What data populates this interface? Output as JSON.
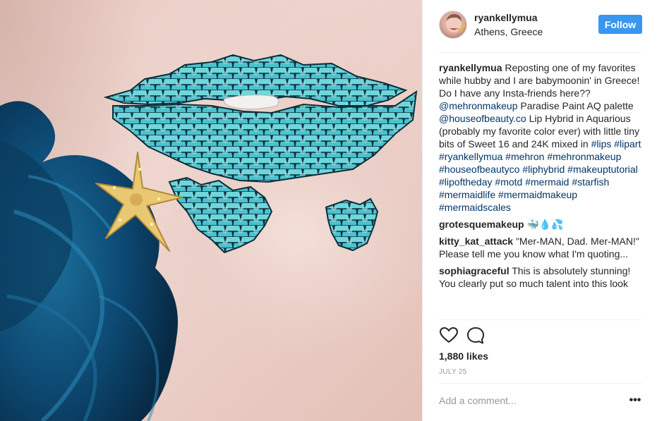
{
  "post": {
    "username": "ryankellymua",
    "location": "Athens, Greece",
    "follow_label": "Follow",
    "avatar_alt": "ryankellymua avatar"
  },
  "caption": {
    "user": "ryankellymua",
    "text_1": " Reposting one of my favorites while hubby and I are babymoonin' in Greece! Do I have any Insta-friends here?? ",
    "mention_1": "@mehronmakeup",
    "text_2": " Paradise Paint AQ palette ",
    "mention_2": "@houseofbeauty.co",
    "text_3": " Lip Hybrid in Aquarious (probably my favorite color ever) with little tiny bits of Sweet 16 and 24K mixed in ",
    "hashtags": [
      "#lips",
      "#lipart",
      "#ryankellymua",
      "#mehron",
      "#mehronmakeup",
      "#houseofbeautyco",
      "#liphybrid",
      "#makeuptutorial",
      "#lipoftheday",
      "#motd",
      "#mermaid",
      "#starfish",
      "#mermaidlife",
      "#mermaidmakeup",
      "#mermaidscales"
    ]
  },
  "comments": [
    {
      "user": "grotesquemakeup",
      "text": " 🐳💧💦"
    },
    {
      "user": "kitty_kat_attack",
      "text": " \"Mer-MAN, Dad. Mer-MAN!\" Please tell me you know what I'm quoting..."
    },
    {
      "user": "sophiagraceful",
      "text": " This is absolutely stunning! You clearly put so much talent into this look"
    }
  ],
  "actions": {
    "like_icon": "heart-icon",
    "comment_icon": "speech-bubble-icon"
  },
  "likes": "1,880 likes",
  "date": "JULY 25",
  "add_comment": {
    "placeholder": "Add a comment..."
  },
  "more_label": "•••",
  "colors": {
    "follow_bg": "#3897f0",
    "link": "#003569",
    "muted": "#999999",
    "scale_teal": "#3fb6c8",
    "hair_blue": "#0e4e7a"
  }
}
